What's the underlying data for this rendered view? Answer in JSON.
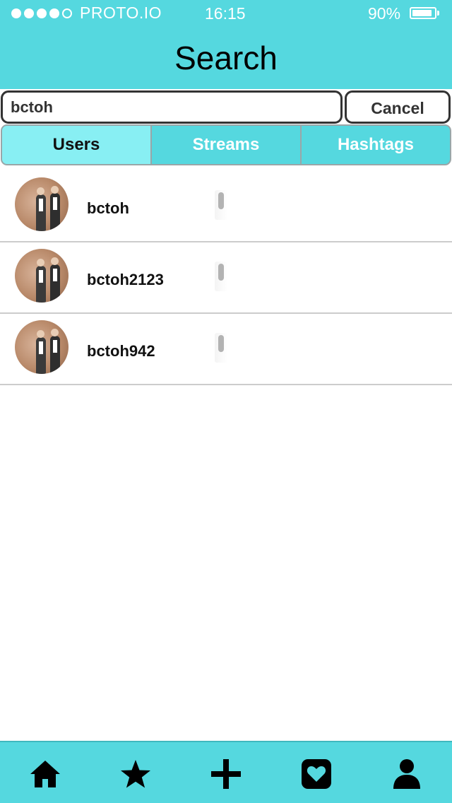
{
  "status_bar": {
    "carrier": "PROTO.IO",
    "time": "16:15",
    "battery_percent": "90%",
    "battery_level": 0.9,
    "signal_bars_filled": 4,
    "signal_bars_total": 5
  },
  "header": {
    "title": "Search"
  },
  "search": {
    "value": "bctoh",
    "cancel_label": "Cancel"
  },
  "tabs": [
    {
      "label": "Users",
      "active": true
    },
    {
      "label": "Streams",
      "active": false
    },
    {
      "label": "Hashtags",
      "active": false
    }
  ],
  "results": [
    {
      "username": "bctoh"
    },
    {
      "username": "bctoh2123"
    },
    {
      "username": "bctoh942"
    }
  ],
  "tabbar": {
    "icons": [
      "home-icon",
      "star-icon",
      "plus-icon",
      "heart-icon",
      "profile-icon"
    ]
  },
  "colors": {
    "accent": "#55d8df",
    "active_tab": "#88eff3",
    "dark": "#333333"
  }
}
